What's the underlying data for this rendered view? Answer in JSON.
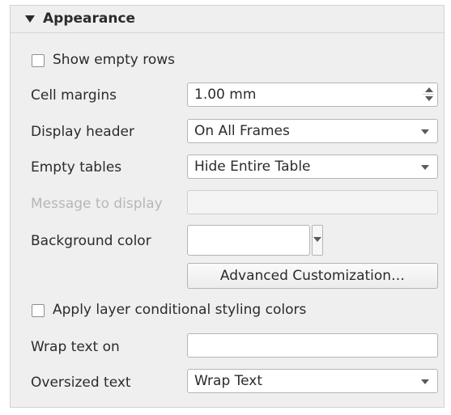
{
  "group": {
    "title": "Appearance"
  },
  "show_empty_rows": {
    "label": "Show empty rows",
    "checked": false
  },
  "cell_margins": {
    "label": "Cell margins",
    "value": "1.00 mm"
  },
  "display_header": {
    "label": "Display header",
    "value": "On All Frames"
  },
  "empty_tables": {
    "label": "Empty tables",
    "value": "Hide Entire Table"
  },
  "message_to_display": {
    "label": "Message to display",
    "value": ""
  },
  "background_color": {
    "label": "Background color",
    "value": "#ffffff"
  },
  "advanced_button": {
    "label": "Advanced Customization…"
  },
  "apply_conditional": {
    "label": "Apply layer conditional styling colors",
    "checked": false
  },
  "wrap_text_on": {
    "label": "Wrap text on",
    "value": ""
  },
  "oversized_text": {
    "label": "Oversized text",
    "value": "Wrap Text"
  }
}
